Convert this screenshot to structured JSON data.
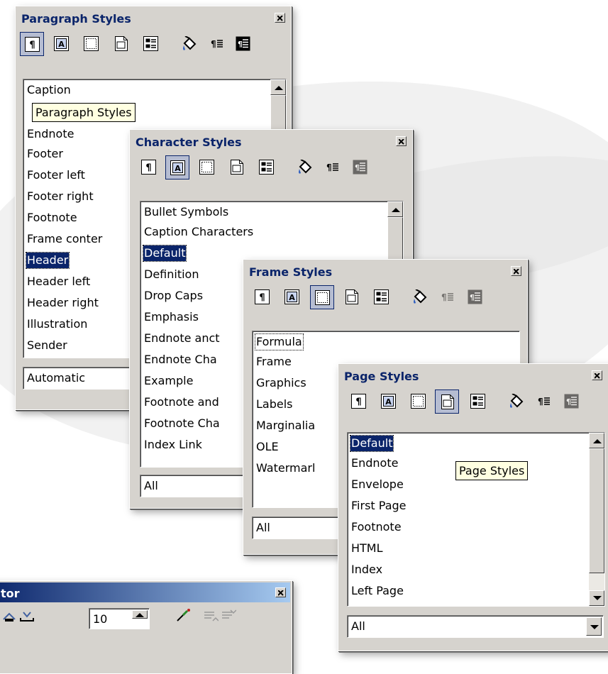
{
  "paragraph_styles": {
    "title": "Paragraph Styles",
    "items": [
      "Caption",
      "Endnote",
      "Footer",
      "Footer left",
      "Footer right",
      "Footnote",
      "Frame conter",
      "Header",
      "Header left",
      "Header right",
      "Illustration",
      "Sender"
    ],
    "selected": "Header",
    "filter": "Automatic",
    "tooltip": "Paragraph Styles"
  },
  "character_styles": {
    "title": "Character Styles",
    "items": [
      "Bullet Symbols",
      "Caption Characters",
      "Default",
      "Definition",
      "Drop Caps",
      "Emphasis",
      "Endnote anct",
      "Endnote Cha",
      "Example",
      "Footnote and",
      "Footnote Cha",
      "Index Link"
    ],
    "selected": "Default",
    "filter": "All"
  },
  "frame_styles": {
    "title": "Frame Styles",
    "items": [
      "Formula",
      "Frame",
      "Graphics",
      "Labels",
      "Marginalia",
      "OLE",
      "Watermarl"
    ],
    "focused": "Formula",
    "filter": "All"
  },
  "page_styles": {
    "title": "Page Styles",
    "items": [
      "Default",
      "Endnote",
      "Envelope",
      "First Page",
      "Footnote",
      "HTML",
      "Index",
      "Left Page"
    ],
    "selected": "Default",
    "filter": "All",
    "tooltip": "Page Styles"
  },
  "navigator": {
    "title": "tor",
    "spin_value": "10"
  },
  "toolbar_icons": [
    "paragraph-styles-icon",
    "character-styles-icon",
    "frame-styles-icon",
    "page-styles-icon",
    "numbering-styles-icon",
    "fill-format-icon",
    "new-style-icon",
    "update-style-icon"
  ],
  "colors": {
    "title_text": "#0a246a",
    "selection": "#0a246a",
    "dialog_bg": "#d6d3ce",
    "tooltip_bg": "#ffffe1"
  }
}
